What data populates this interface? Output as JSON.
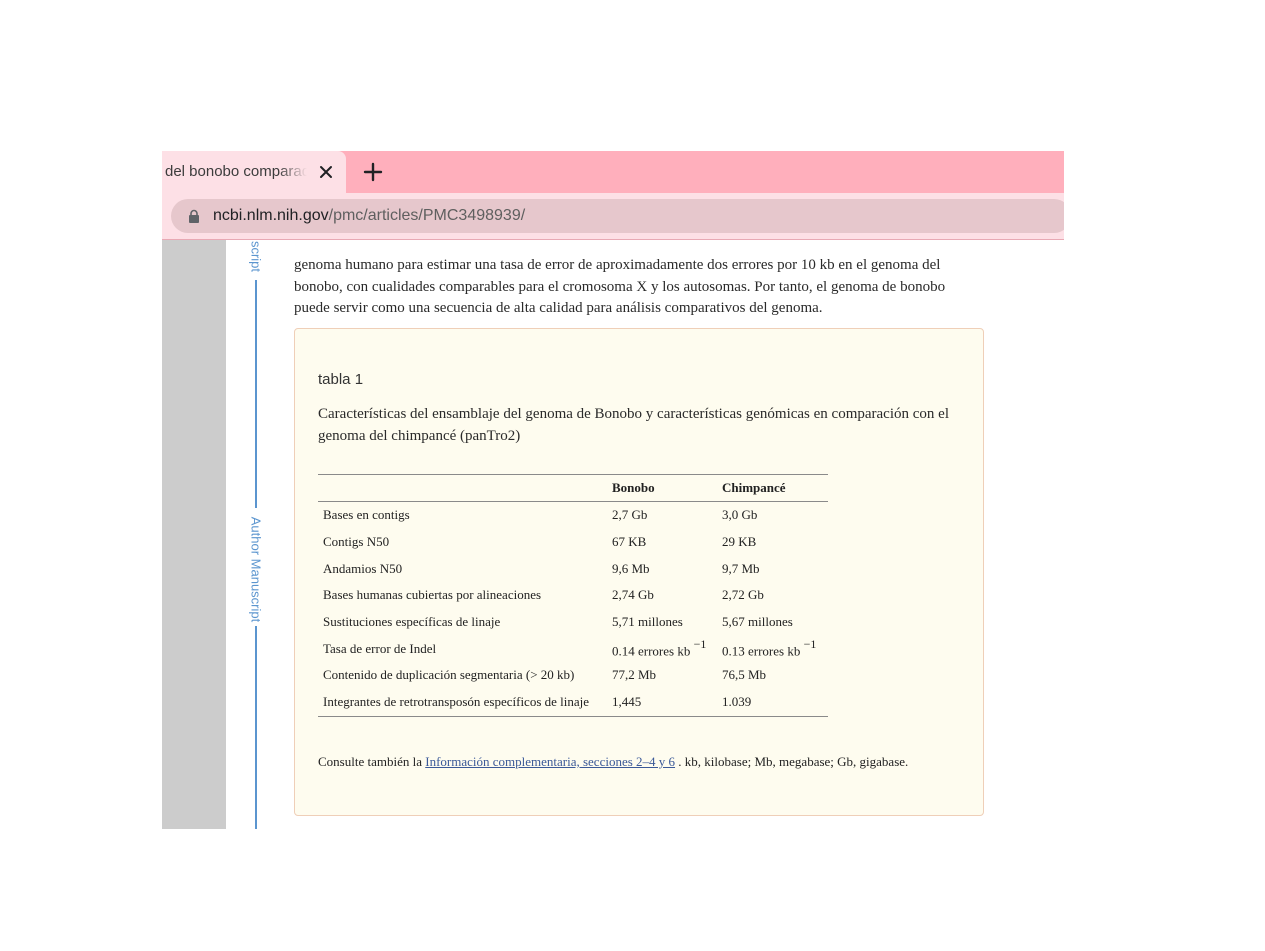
{
  "browser": {
    "tab_title": "del bonobo comparado",
    "url_host": "ncbi.nlm.nih.gov",
    "url_path": "/pmc/articles/PMC3498939/"
  },
  "sidebar": {
    "label_top": "script",
    "label_mid": "Author Manuscript"
  },
  "article": {
    "paragraph": "genoma humano para estimar una tasa de error de aproximadamente dos errores por 10 kb en el genoma del bonobo, con cualidades comparables para el cromosoma X y los autosomas. Por tanto, el genoma de bonobo puede servir como una secuencia de alta calidad para análisis comparativos del genoma."
  },
  "table": {
    "label": "tabla 1",
    "caption": "Características del ensamblaje del genoma de Bonobo y características genómicas en comparación con el genoma del chimpancé (panTro2)",
    "headers": [
      "",
      "Bonobo",
      "Chimpancé"
    ],
    "rows": [
      {
        "feature": "Bases en contigs",
        "bonobo": "2,7 Gb",
        "chimp": "3,0 Gb"
      },
      {
        "feature": "Contigs N50",
        "bonobo": "67 KB",
        "chimp": "29 KB"
      },
      {
        "feature": "Andamios N50",
        "bonobo": "9,6 Mb",
        "chimp": "9,7 Mb"
      },
      {
        "feature": "Bases humanas cubiertas por alineaciones",
        "bonobo": "2,74 Gb",
        "chimp": "2,72 Gb"
      },
      {
        "feature": "Sustituciones específicas de linaje",
        "bonobo": "5,71 millones",
        "chimp": "5,67 millones"
      },
      {
        "feature": "Tasa de error de Indel",
        "bonobo": "0.14 errores kb",
        "bonobo_sup": "−1",
        "chimp": "0.13 errores kb",
        "chimp_sup": "−1"
      },
      {
        "feature": "Contenido de duplicación segmentaria (> 20 kb)",
        "bonobo": "77,2 Mb",
        "chimp": "76,5 Mb"
      },
      {
        "feature": "Integrantes de retrotransposón específicos de linaje",
        "bonobo": "1,445",
        "chimp": "1.039"
      }
    ],
    "footnote_prefix": "Consulte también la",
    "footnote_link": "Información complementaria, secciones 2–4 y 6",
    "footnote_suffix": ". kb, kilobase; Mb, megabase; Gb, gigabase."
  }
}
